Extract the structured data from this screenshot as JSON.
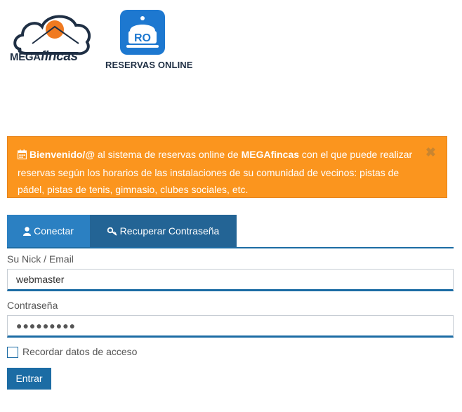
{
  "logos": {
    "mega_prefix": "MEGA",
    "mega_suffix": "fincas",
    "ro_badge": "RO",
    "ro_caption": "RESERVAS ONLINE"
  },
  "alert": {
    "icon": "calendar-icon",
    "part1": "Bienvenido/@",
    "part2": " al sistema de reservas online de ",
    "part3": "MEGAfincas",
    "part4": " con el que puede realizar reservas según los horarios de las instalaciones de su comunidad de vecinos: pistas de pádel, pistas de tenis, gimnasio, clubes sociales, etc.",
    "close_symbol": "✖",
    "background_color": "#fb951e"
  },
  "tabs": [
    {
      "label": "Conectar",
      "icon": "user-icon",
      "active": true
    },
    {
      "label": "Recuperar Contraseña",
      "icon": "key-icon",
      "active": false
    }
  ],
  "form": {
    "nick_label": "Su Nick / Email",
    "nick_value": "webmaster",
    "password_label": "Contraseña",
    "password_value": "●●●●●●●●●",
    "remember_label": "Recordar datos de acceso",
    "remember_checked": false,
    "submit_label": "Entrar"
  },
  "colors": {
    "primary": "#1c6ca4",
    "tab_active": "#2b80c2",
    "tab_inactive": "#236495"
  }
}
